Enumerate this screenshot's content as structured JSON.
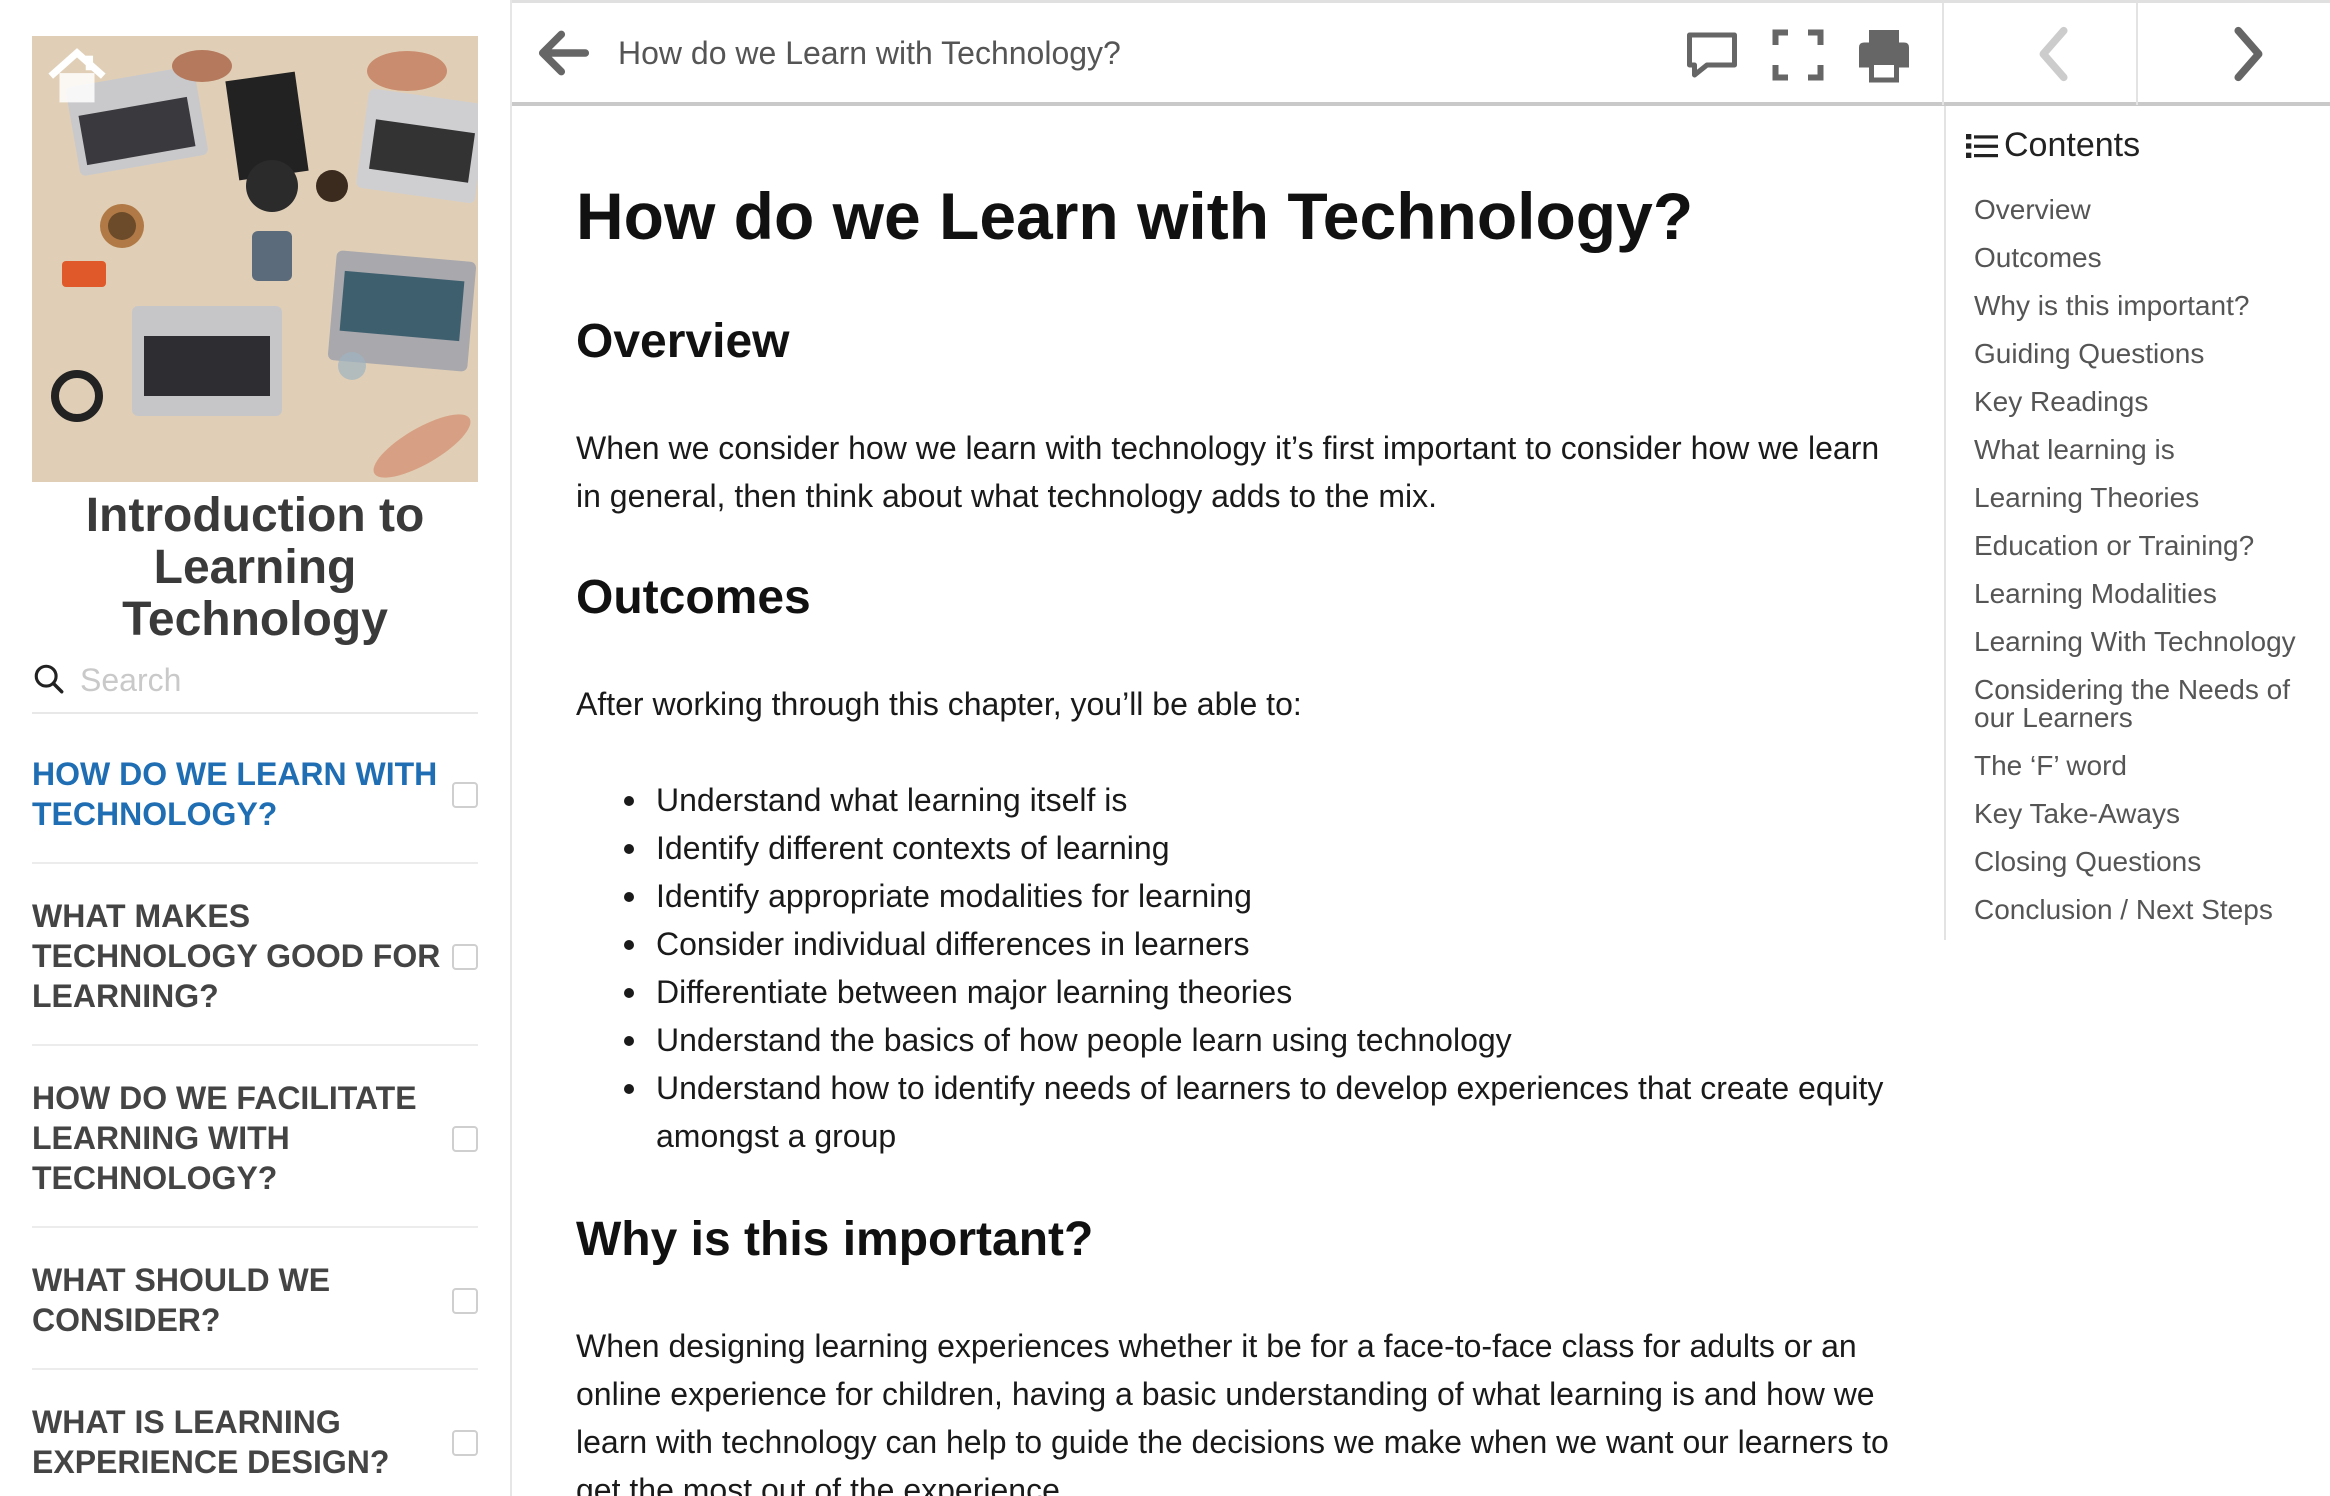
{
  "sidebar": {
    "book_title": "Introduction to Learning Technology",
    "search_placeholder": "Search",
    "chapters": [
      {
        "label": "HOW DO WE LEARN WITH TECHNOLOGY?",
        "active": true
      },
      {
        "label": "WHAT MAKES TECHNOLOGY GOOD FOR LEARNING?",
        "active": false
      },
      {
        "label": "HOW DO WE FACILITATE LEARNING WITH TECHNOLOGY?",
        "active": false
      },
      {
        "label": "WHAT SHOULD WE CONSIDER?",
        "active": false
      },
      {
        "label": "WHAT IS LEARNING EXPERIENCE DESIGN?",
        "active": false
      }
    ]
  },
  "topbar": {
    "page_heading": "How do we Learn with Technology?",
    "icons": [
      "arrow-left-icon",
      "comment-icon",
      "fullscreen-icon",
      "print-icon",
      "chevron-left-icon",
      "chevron-right-icon"
    ]
  },
  "content": {
    "title": "How do we Learn with Technology?",
    "overview_heading": "Overview",
    "overview_text": "When we consider how we learn with technology it’s first important to consider how we learn in general, then think about what technology adds to the mix.",
    "outcomes_heading": "Outcomes",
    "outcomes_intro": "After working through this chapter, you’ll be able to:",
    "outcomes": [
      "Understand what learning itself is",
      "Identify different contexts of learning",
      "Identify appropriate modalities for learning",
      "Consider individual differences in learners",
      "Differentiate between major learning theories",
      "Understand the basics of how people learn using technology",
      "Understand how to identify needs of learners to develop experiences that create equity amongst a group"
    ],
    "why_heading": "Why is this important?",
    "why_text": "When designing learning experiences whether it be for a face-to-face class for adults or an online experience for children, having a basic understanding of what learning is and how we learn with technology can help to guide the decisions we make when we want our learners to get the most out of the experience."
  },
  "toc": {
    "header": "Contents",
    "items": [
      "Overview",
      "Outcomes",
      "Why is this important?",
      "Guiding Questions",
      "Key Readings",
      "What learning is",
      "Learning Theories",
      "Education or Training?",
      "Learning Modalities",
      "Learning With Technology",
      "Considering the Needs of our Learners",
      "The ‘F’ word",
      "Key Take-Aways",
      "Closing Questions",
      "Conclusion / Next Steps"
    ]
  },
  "colors": {
    "active_chapter": "#1f6eb4",
    "chapter_text": "#444444",
    "toc_text": "#555555",
    "icon_gray": "#666666",
    "disabled_gray": "#cccccc"
  }
}
